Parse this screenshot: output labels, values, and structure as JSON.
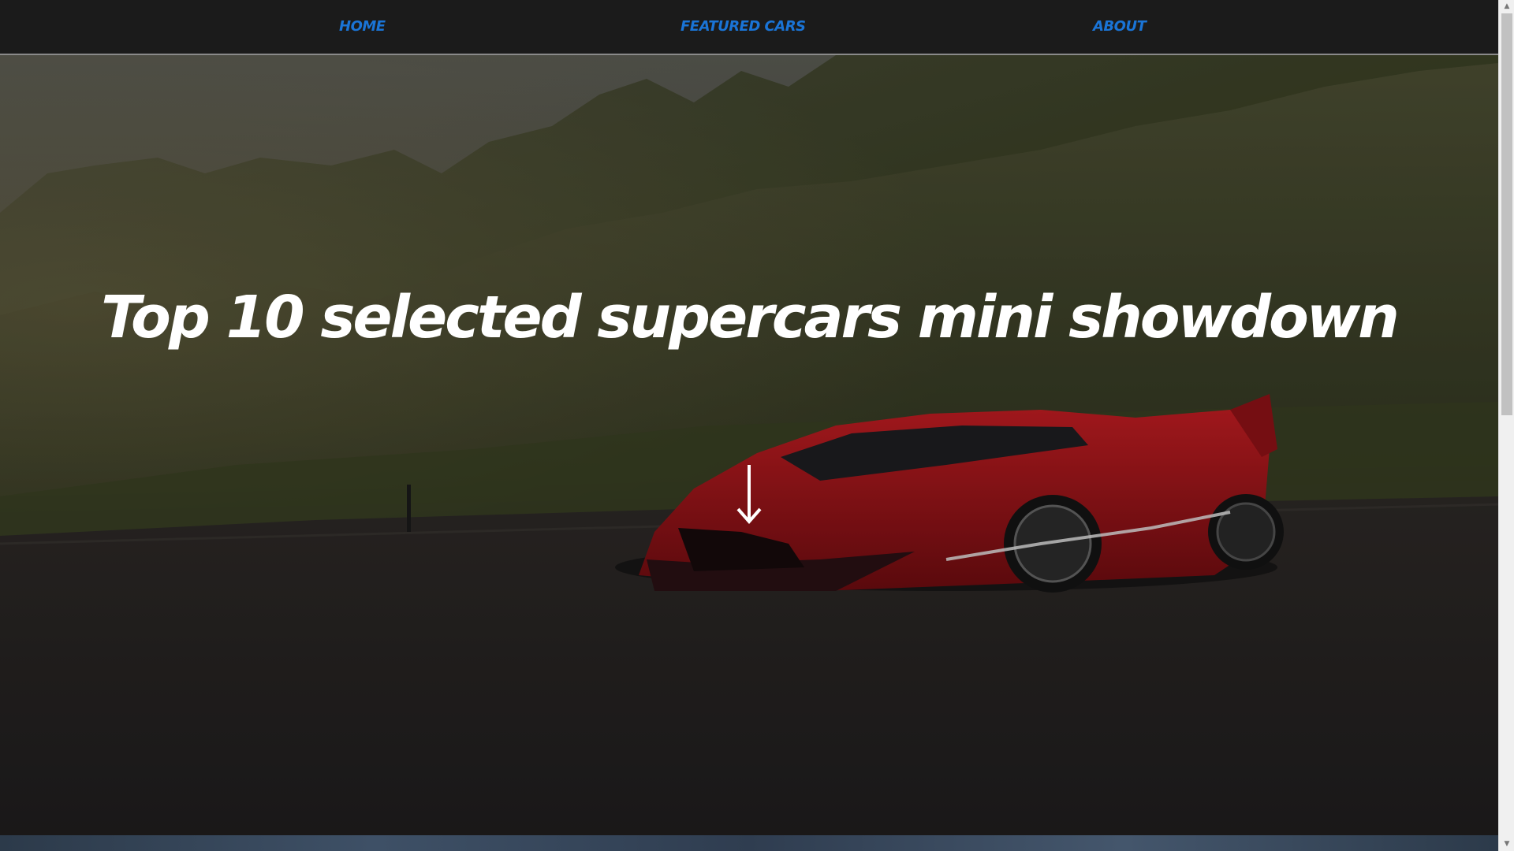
{
  "nav": {
    "items": [
      {
        "label": "HOME"
      },
      {
        "label": "FEATURED CARS"
      },
      {
        "label": "ABOUT"
      }
    ]
  },
  "hero": {
    "title": "Top 10 selected supercars mini showdown",
    "scroll_icon": "arrow-down-icon"
  },
  "scrollbar": {
    "up_icon": "▲",
    "down_icon": "▼"
  },
  "colors": {
    "nav_background": "#1b1b1b",
    "nav_link": "#1a74d6",
    "title": "#ffffff",
    "car_body": "#a8141a"
  }
}
